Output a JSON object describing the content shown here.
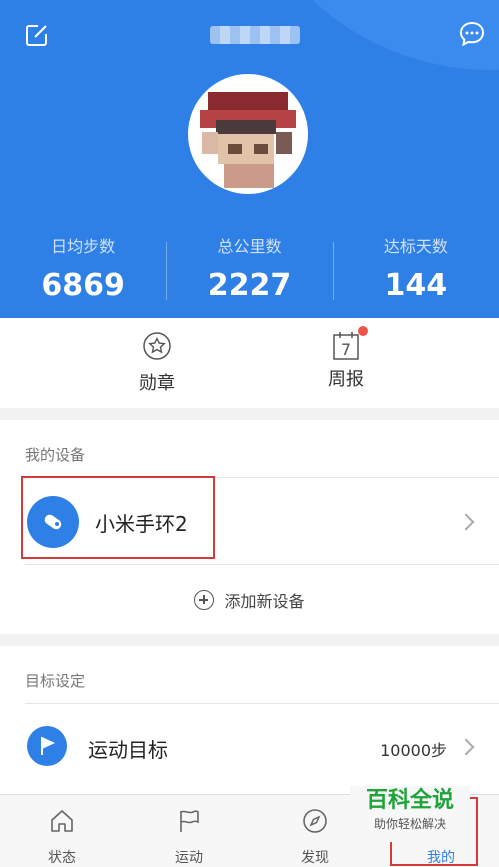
{
  "header": {
    "edit_icon": "edit-icon",
    "chat_icon": "chat-bubble-icon",
    "colors": {
      "primary": "#2f80e6",
      "secondary": "#3b8aed"
    }
  },
  "stats": [
    {
      "label": "日均步数",
      "value": "6869"
    },
    {
      "label": "总公里数",
      "value": "2227"
    },
    {
      "label": "达标天数",
      "value": "144"
    }
  ],
  "quick": {
    "medal_label": "勋章",
    "weekly_label": "周报",
    "weekly_calendar_number": "7"
  },
  "devices": {
    "section_title": "我的设备",
    "device_name": "小米手环2",
    "add_label": "添加新设备"
  },
  "goals": {
    "section_title": "目标设定",
    "goal_name": "运动目标",
    "goal_value": "10000步"
  },
  "tabs": [
    {
      "label": "状态",
      "icon": "home-icon"
    },
    {
      "label": "运动",
      "icon": "flag-icon"
    },
    {
      "label": "发现",
      "icon": "compass-icon"
    },
    {
      "label": "我的",
      "icon": "person-icon"
    }
  ],
  "watermark": {
    "title": "百科全说",
    "subtitle": "助你轻松解决"
  }
}
